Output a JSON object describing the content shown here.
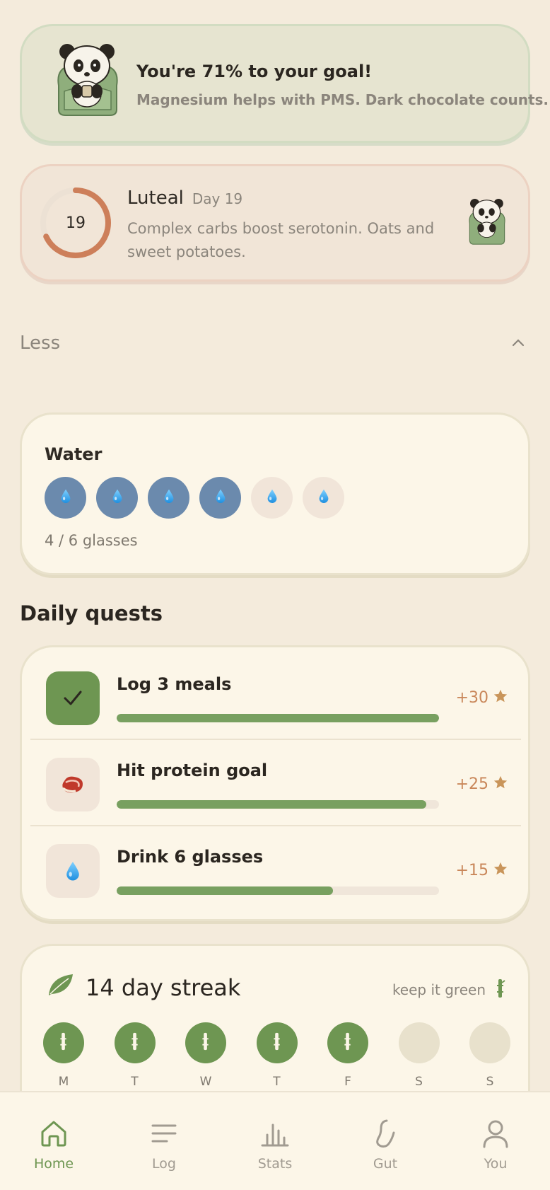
{
  "goal_banner": {
    "title": "You're 71% to your goal!",
    "subtitle": "Magnesium helps with PMS. Dark chocolate counts."
  },
  "cycle": {
    "day_number": "19",
    "phase": "Luteal",
    "day_label": "Day 19",
    "tip": "Complex carbs boost serotonin. Oats and sweet potatoes.",
    "progress_fraction": 0.68
  },
  "toggle": {
    "label": "Less"
  },
  "water": {
    "title": "Water",
    "filled": 4,
    "total": 6,
    "count_text": "4 / 6 glasses"
  },
  "quests": {
    "title": "Daily quests",
    "items": [
      {
        "label": "Log 3 meals",
        "points": "+30",
        "progress": 1.0,
        "icon": "check-icon",
        "done": true
      },
      {
        "label": "Hit protein goal",
        "points": "+25",
        "progress": 0.96,
        "icon": "meat-icon",
        "done": false
      },
      {
        "label": "Drink 6 glasses",
        "points": "+15",
        "progress": 0.67,
        "icon": "water-drop-icon",
        "done": false
      }
    ]
  },
  "streak": {
    "title": "14 day streak",
    "hint": "keep it green",
    "days": [
      {
        "label": "M",
        "done": true
      },
      {
        "label": "T",
        "done": true
      },
      {
        "label": "W",
        "done": true
      },
      {
        "label": "T",
        "done": true
      },
      {
        "label": "F",
        "done": true
      },
      {
        "label": "S",
        "done": false
      },
      {
        "label": "S",
        "done": false
      }
    ]
  },
  "nav": {
    "items": [
      {
        "label": "Home",
        "icon": "home-icon",
        "active": true
      },
      {
        "label": "Log",
        "icon": "list-icon",
        "active": false
      },
      {
        "label": "Stats",
        "icon": "stats-icon",
        "active": false
      },
      {
        "label": "Gut",
        "icon": "gut-icon",
        "active": false
      },
      {
        "label": "You",
        "icon": "profile-icon",
        "active": false
      }
    ]
  },
  "colors": {
    "accent_green": "#6e9652",
    "water_blue": "#6b8aad",
    "cycle_ring": "#cd7f5a",
    "reward_star": "#c9955a"
  }
}
